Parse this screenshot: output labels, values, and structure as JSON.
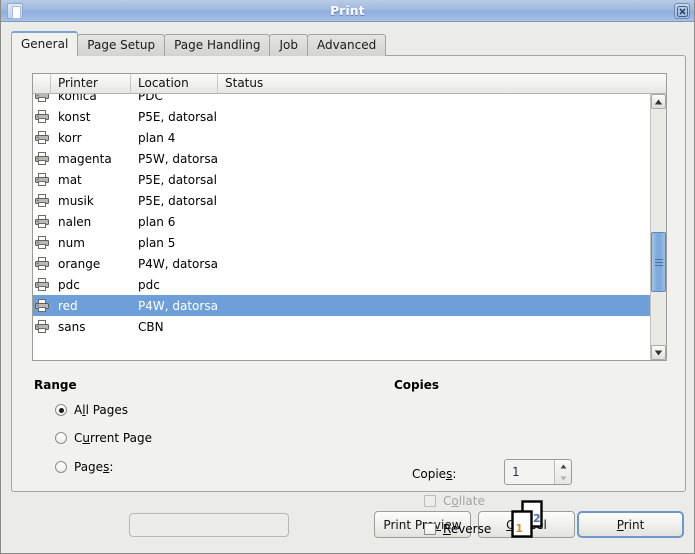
{
  "window": {
    "title": "Print",
    "icon": "document-icon",
    "close_icon": "close-icon"
  },
  "tabs": [
    {
      "label": "General",
      "active": true
    },
    {
      "label": "Page Setup",
      "active": false
    },
    {
      "label": "Page Handling",
      "active": false
    },
    {
      "label": "Job",
      "active": false
    },
    {
      "label": "Advanced",
      "active": false
    }
  ],
  "printer_list": {
    "columns": [
      "",
      "Printer",
      "Location",
      "Status"
    ],
    "rows": [
      {
        "printer": "konica",
        "location": "PDC",
        "status": "",
        "selected": false
      },
      {
        "printer": "konst",
        "location": "P5E, datorsal",
        "status": "",
        "selected": false
      },
      {
        "printer": "korr",
        "location": "plan 4",
        "status": "",
        "selected": false
      },
      {
        "printer": "magenta",
        "location": "P5W, datorsal",
        "status": "",
        "selected": false
      },
      {
        "printer": "mat",
        "location": "P5E, datorsal",
        "status": "",
        "selected": false
      },
      {
        "printer": "musik",
        "location": "P5E, datorsal",
        "status": "",
        "selected": false
      },
      {
        "printer": "nalen",
        "location": "plan 6",
        "status": "",
        "selected": false
      },
      {
        "printer": "num",
        "location": "plan 5",
        "status": "",
        "selected": false
      },
      {
        "printer": "orange",
        "location": "P4W, datorsal",
        "status": "",
        "selected": false
      },
      {
        "printer": "pdc",
        "location": "pdc",
        "status": "",
        "selected": false
      },
      {
        "printer": "red",
        "location": "P4W, datorsal",
        "status": "",
        "selected": true
      },
      {
        "printer": "sans",
        "location": "CBN",
        "status": "",
        "selected": false
      }
    ],
    "selection_color": "#6f9fd8",
    "scrollbar": {
      "thumb_color": "#7faadd",
      "up_icon": "scroll-up-icon",
      "down_icon": "scroll-down-icon"
    }
  },
  "range": {
    "title": "Range",
    "options": [
      {
        "label_pre": "A",
        "label_mnemonic": "l",
        "label_post": "l Pages",
        "checked": true
      },
      {
        "label_pre": "C",
        "label_mnemonic": "u",
        "label_post": "rrent Page",
        "checked": false
      },
      {
        "label_pre": "Page",
        "label_mnemonic": "s",
        "label_post": ":",
        "checked": false
      }
    ],
    "pages_value": "",
    "pages_placeholder": ""
  },
  "copies": {
    "title": "Copies",
    "copies_label_pre": "Copie",
    "copies_label_mnemonic": "s",
    "copies_label_post": ":",
    "copies_value": "1",
    "collate": {
      "label_pre": "C",
      "label_mnemonic": "o",
      "label_post": "llate",
      "checked": false,
      "enabled": false
    },
    "reverse": {
      "label_pre": "",
      "label_mnemonic": "R",
      "label_post": "everse",
      "checked": false,
      "enabled": true
    },
    "preview": {
      "front_page_number": "1",
      "back_page_number": "2"
    }
  },
  "buttons": {
    "preview": {
      "pre": "Print Pre",
      "mnemonic": "v",
      "post": "iew"
    },
    "cancel": {
      "pre": "",
      "mnemonic": "C",
      "post": "ancel"
    },
    "print": {
      "pre": "",
      "mnemonic": "P",
      "post": "rint"
    }
  }
}
